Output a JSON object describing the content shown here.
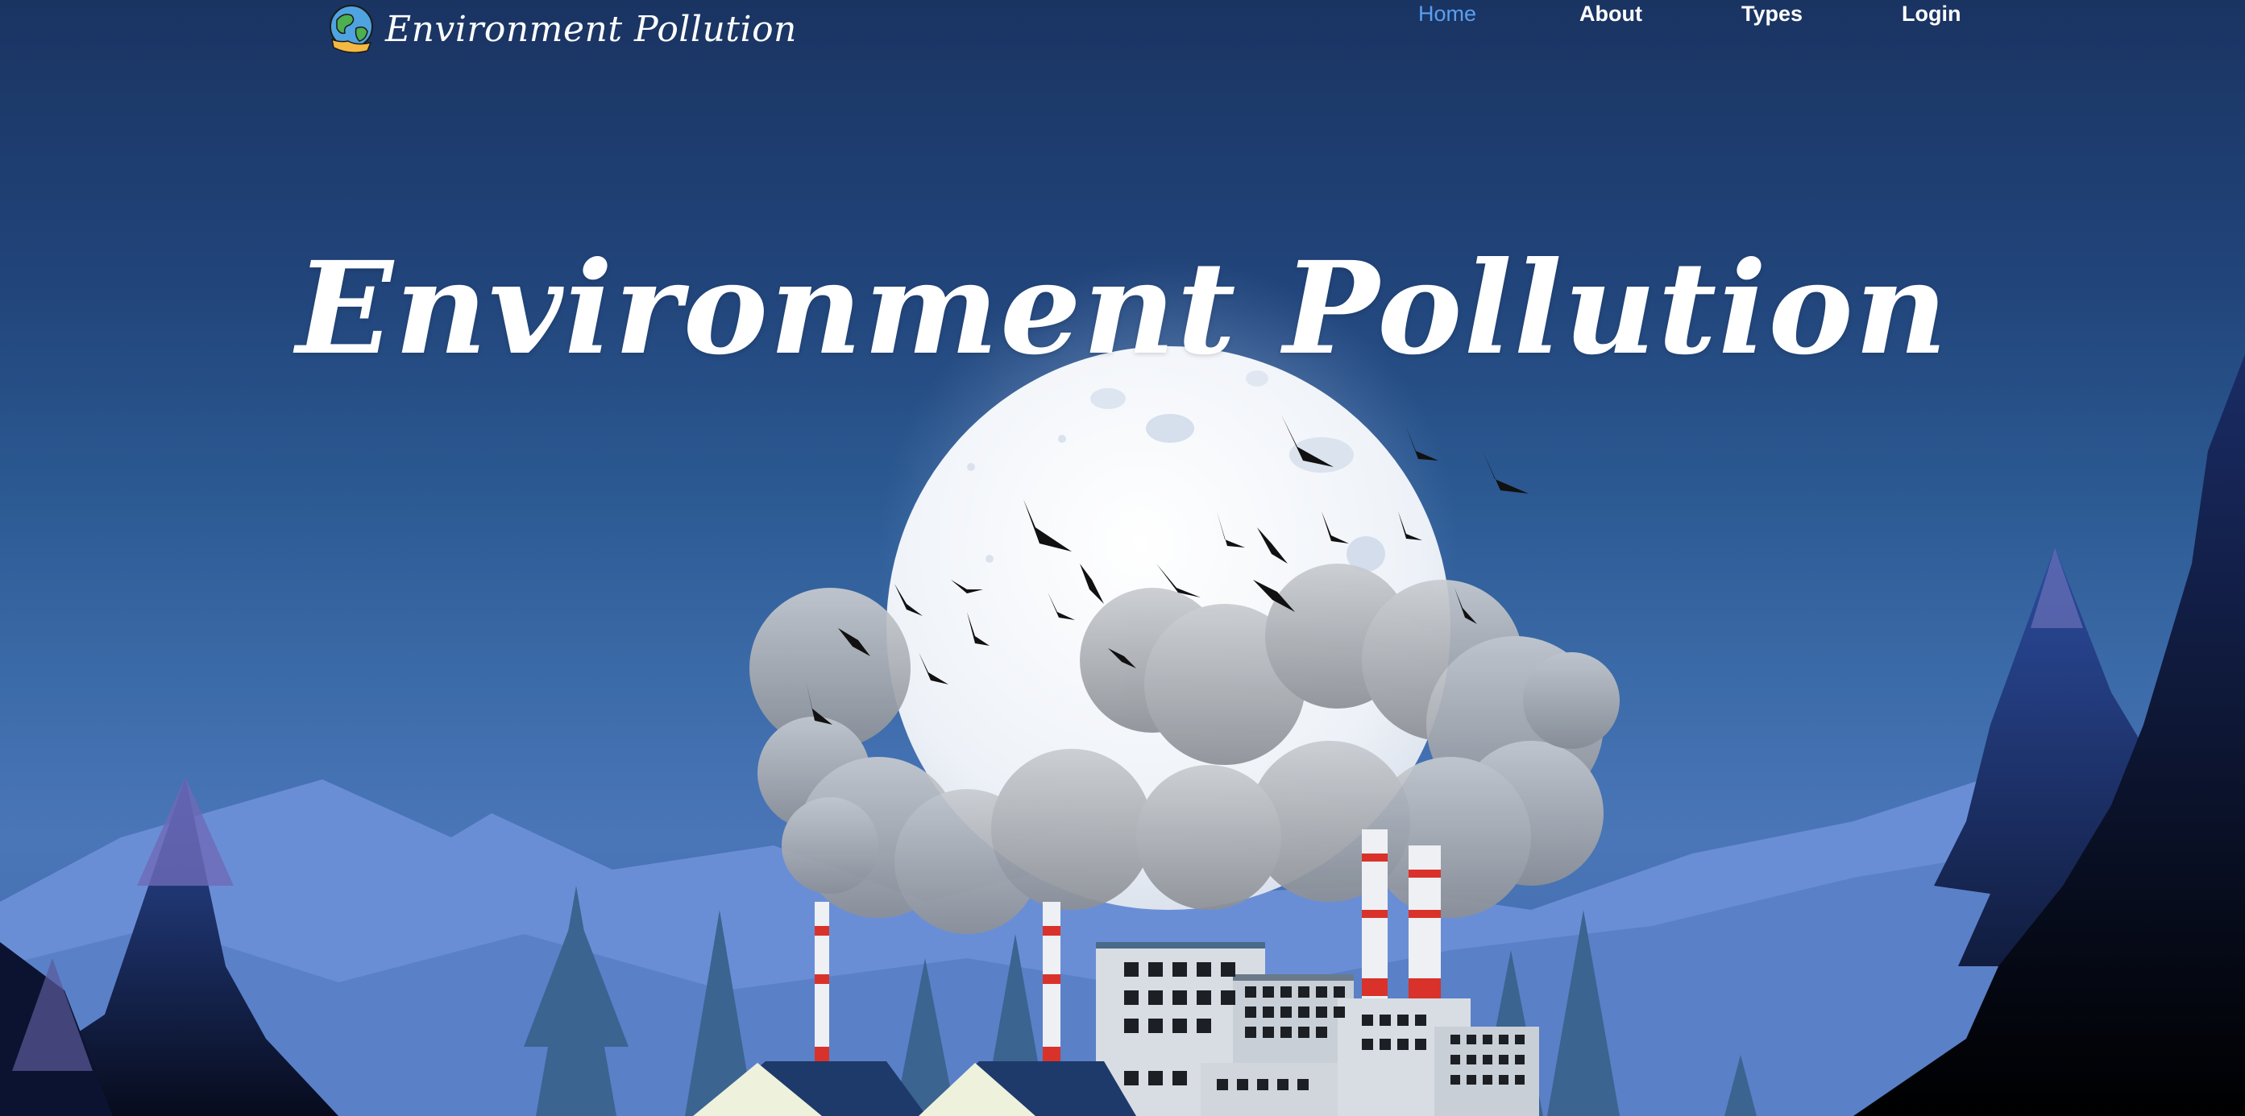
{
  "brand": {
    "name": "Environment Pollution",
    "logo_icon": "globe-hand-icon"
  },
  "nav": {
    "items": [
      {
        "label": "Home",
        "active": true
      },
      {
        "label": "About",
        "active": false
      },
      {
        "label": "Types",
        "active": false
      },
      {
        "label": "Login",
        "active": false
      }
    ]
  },
  "hero": {
    "title": "Environment Pollution"
  },
  "colors": {
    "sky_top": "#1a3462",
    "sky_bottom": "#4a76b8",
    "nav_active": "#5b9ff0",
    "chimney_stripe": "#d9322a"
  }
}
